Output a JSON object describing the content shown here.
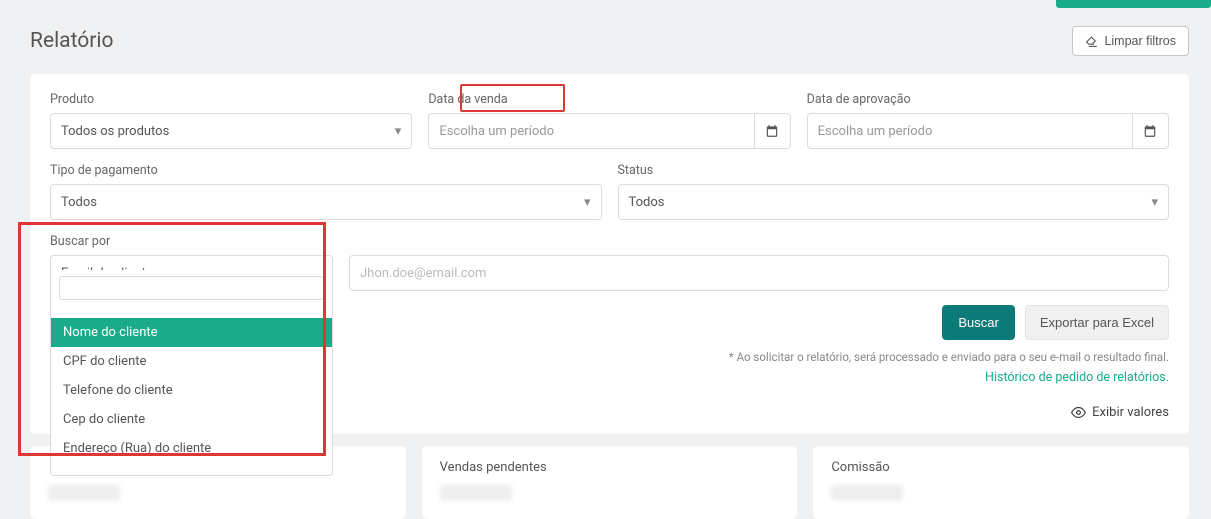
{
  "header": {
    "title": "Relatório",
    "clear_filters": "Limpar filtros"
  },
  "filters": {
    "product": {
      "label": "Produto",
      "value": "Todos os produtos"
    },
    "sale_date": {
      "label": "Data da venda",
      "placeholder": "Escolha um período"
    },
    "approval_date": {
      "label": "Data de aprovação",
      "placeholder": "Escolha um período"
    },
    "payment_type": {
      "label": "Tipo de pagamento",
      "value": "Todos"
    },
    "status": {
      "label": "Status",
      "value": "Todos"
    },
    "search_by": {
      "label": "Buscar por",
      "value": "Email do cliente",
      "options": [
        "Nome do cliente",
        "CPF do cliente",
        "Telefone do cliente",
        "Cep do cliente",
        "Endereço (Rua) do cliente"
      ]
    },
    "search_input_placeholder": "Jhon.doe@email.com"
  },
  "actions": {
    "search": "Buscar",
    "export": "Exportar para Excel",
    "note": "* Ao solicitar o relatório, será processado e enviado para o seu e-mail o resultado final.",
    "history_link": "Histórico de pedido de relatórios.",
    "show_values": "Exibir valores"
  },
  "cards": {
    "pending": "Vendas pendentes",
    "commission": "Comissão"
  }
}
